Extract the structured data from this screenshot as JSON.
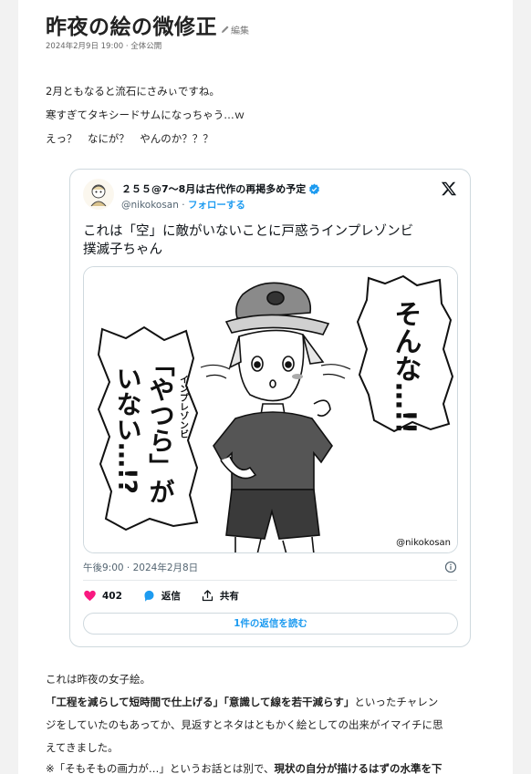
{
  "post": {
    "title": "昨夜の絵の微修正",
    "edit_label": "編集",
    "meta": "2024年2月9日 19:00 · 全体公開",
    "intro_lines": [
      "2月ともなると流石にさみぃですね。",
      "寒すぎてタキシードサムになっちゃう…ｗ",
      "えっ？　なにが？　やんのか？？？"
    ]
  },
  "tweet": {
    "author_name": "２５５@7～8月は古代作の再掲多め予定",
    "handle": "@nikokosan",
    "separator": "·",
    "follow_label": "フォローする",
    "text_line1": "これは「空」に敵がいないことに戸惑うインプレゾンビ",
    "text_line2": "撲滅子ちゃん",
    "image": {
      "bubble_right": "そんな…!!",
      "bubble_left_col1": "「やつら」が",
      "bubble_left_col2": "いない…!?",
      "small_label": "インプレゾンビ",
      "signature": "@nikokosan"
    },
    "timestamp": "午後9:00 · 2024年2月8日",
    "likes": "402",
    "reply_label": "返信",
    "share_label": "共有",
    "read_replies": "1件の返信を読む",
    "icons": [
      "x-logo-icon",
      "verified-icon",
      "info-icon",
      "heart-icon",
      "reply-icon",
      "share-icon"
    ],
    "colors": {
      "accent": "#1d9bf0",
      "heart": "#f91880"
    }
  },
  "footer": {
    "line1": "これは昨夜の女子絵。",
    "bold1": "「工程を減らして短時間で仕上げる」",
    "bold2": "「意識して線を若干減らす」",
    "line2_rest": "といったチャレン",
    "line3": "ジをしていたのもあってか、見返すとネタはともかく絵としての出来がイマイチに思",
    "line4": "えてきました。",
    "note_start": "※「そもそもの画力が…」というお話とは別で、",
    "note_bold": "現状の自分が描けるはずの水準を下"
  }
}
